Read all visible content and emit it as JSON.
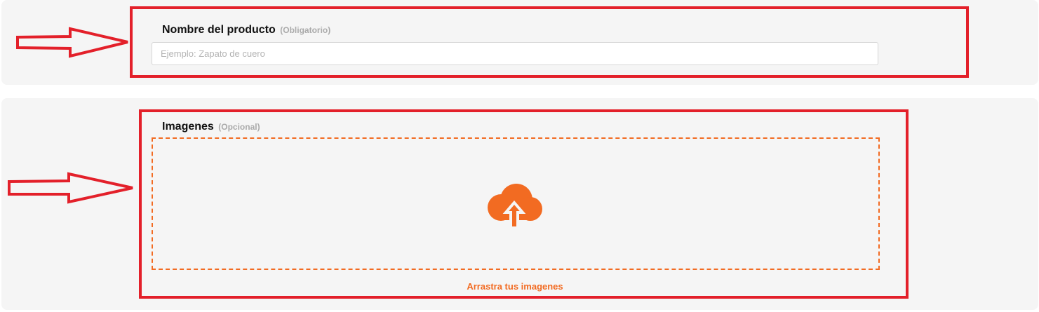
{
  "product_name": {
    "label": "Nombre del producto",
    "hint": "(Obligatorio)",
    "input_value": "",
    "placeholder": "Ejemplo: Zapato de cuero"
  },
  "images": {
    "label": "Imagenes",
    "hint": "(Opcional)",
    "dropzone_caption": "Arrastra tus imagenes",
    "icon": "cloud-upload-icon"
  },
  "colors": {
    "accent": "#f26b22",
    "annotation": "#e3202a",
    "card_background": "#f5f5f5"
  }
}
